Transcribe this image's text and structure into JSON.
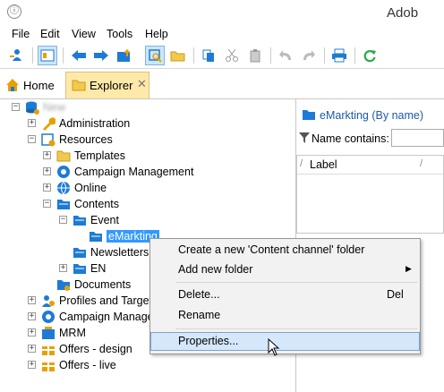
{
  "window": {
    "title": "Adob"
  },
  "menu": [
    "File",
    "Edit",
    "View",
    "Tools",
    "Help"
  ],
  "tabs": {
    "home": "Home",
    "explorer": "Explorer"
  },
  "tree": {
    "root": "New",
    "administration": "Administration",
    "resources": "Resources",
    "templates": "Templates",
    "campaign_management": "Campaign Management",
    "online": "Online",
    "contents": "Contents",
    "event": "Event",
    "emarketing": "eMarkting",
    "newsletters": "Newsletters",
    "en": "EN",
    "documents": "Documents",
    "profiles": "Profiles and Target",
    "campaign_manage": "Campaign Manage",
    "mrm": "MRM",
    "offers_design": "Offers - design",
    "offers_live": "Offers - live"
  },
  "right_panel": {
    "title": "eMarkting (By name)",
    "filter_label": "Name contains:",
    "column_label": "Label"
  },
  "context_menu": {
    "create_folder": "Create a new 'Content channel' folder",
    "add_folder": "Add new folder",
    "delete": "Delete...",
    "delete_shortcut": "Del",
    "rename": "Rename",
    "properties": "Properties..."
  },
  "colors": {
    "accent": "#1d7bd6",
    "folder": "#f2c94c",
    "selection": "#3399ff",
    "tab_active": "#ffe9a8"
  }
}
